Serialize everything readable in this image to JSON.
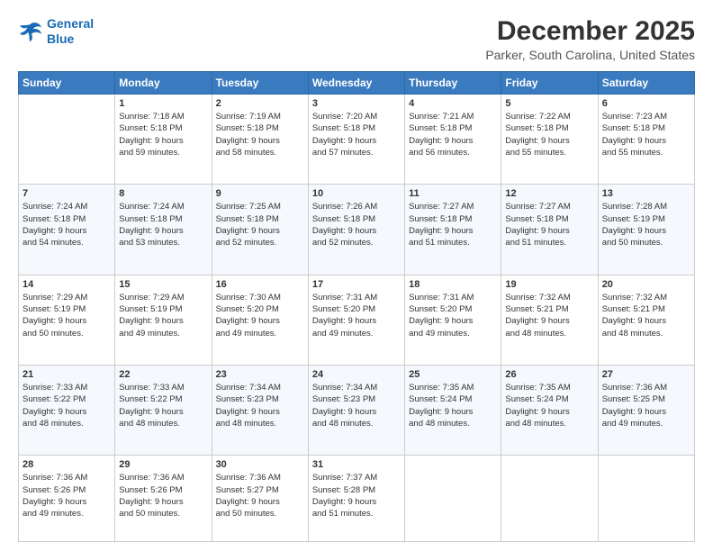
{
  "header": {
    "logo_line1": "General",
    "logo_line2": "Blue",
    "title": "December 2025",
    "subtitle": "Parker, South Carolina, United States"
  },
  "calendar": {
    "days_of_week": [
      "Sunday",
      "Monday",
      "Tuesday",
      "Wednesday",
      "Thursday",
      "Friday",
      "Saturday"
    ],
    "weeks": [
      [
        {
          "day": "",
          "info": ""
        },
        {
          "day": "1",
          "info": "Sunrise: 7:18 AM\nSunset: 5:18 PM\nDaylight: 9 hours\nand 59 minutes."
        },
        {
          "day": "2",
          "info": "Sunrise: 7:19 AM\nSunset: 5:18 PM\nDaylight: 9 hours\nand 58 minutes."
        },
        {
          "day": "3",
          "info": "Sunrise: 7:20 AM\nSunset: 5:18 PM\nDaylight: 9 hours\nand 57 minutes."
        },
        {
          "day": "4",
          "info": "Sunrise: 7:21 AM\nSunset: 5:18 PM\nDaylight: 9 hours\nand 56 minutes."
        },
        {
          "day": "5",
          "info": "Sunrise: 7:22 AM\nSunset: 5:18 PM\nDaylight: 9 hours\nand 55 minutes."
        },
        {
          "day": "6",
          "info": "Sunrise: 7:23 AM\nSunset: 5:18 PM\nDaylight: 9 hours\nand 55 minutes."
        }
      ],
      [
        {
          "day": "7",
          "info": "Sunrise: 7:24 AM\nSunset: 5:18 PM\nDaylight: 9 hours\nand 54 minutes."
        },
        {
          "day": "8",
          "info": "Sunrise: 7:24 AM\nSunset: 5:18 PM\nDaylight: 9 hours\nand 53 minutes."
        },
        {
          "day": "9",
          "info": "Sunrise: 7:25 AM\nSunset: 5:18 PM\nDaylight: 9 hours\nand 52 minutes."
        },
        {
          "day": "10",
          "info": "Sunrise: 7:26 AM\nSunset: 5:18 PM\nDaylight: 9 hours\nand 52 minutes."
        },
        {
          "day": "11",
          "info": "Sunrise: 7:27 AM\nSunset: 5:18 PM\nDaylight: 9 hours\nand 51 minutes."
        },
        {
          "day": "12",
          "info": "Sunrise: 7:27 AM\nSunset: 5:18 PM\nDaylight: 9 hours\nand 51 minutes."
        },
        {
          "day": "13",
          "info": "Sunrise: 7:28 AM\nSunset: 5:19 PM\nDaylight: 9 hours\nand 50 minutes."
        }
      ],
      [
        {
          "day": "14",
          "info": "Sunrise: 7:29 AM\nSunset: 5:19 PM\nDaylight: 9 hours\nand 50 minutes."
        },
        {
          "day": "15",
          "info": "Sunrise: 7:29 AM\nSunset: 5:19 PM\nDaylight: 9 hours\nand 49 minutes."
        },
        {
          "day": "16",
          "info": "Sunrise: 7:30 AM\nSunset: 5:20 PM\nDaylight: 9 hours\nand 49 minutes."
        },
        {
          "day": "17",
          "info": "Sunrise: 7:31 AM\nSunset: 5:20 PM\nDaylight: 9 hours\nand 49 minutes."
        },
        {
          "day": "18",
          "info": "Sunrise: 7:31 AM\nSunset: 5:20 PM\nDaylight: 9 hours\nand 49 minutes."
        },
        {
          "day": "19",
          "info": "Sunrise: 7:32 AM\nSunset: 5:21 PM\nDaylight: 9 hours\nand 48 minutes."
        },
        {
          "day": "20",
          "info": "Sunrise: 7:32 AM\nSunset: 5:21 PM\nDaylight: 9 hours\nand 48 minutes."
        }
      ],
      [
        {
          "day": "21",
          "info": "Sunrise: 7:33 AM\nSunset: 5:22 PM\nDaylight: 9 hours\nand 48 minutes."
        },
        {
          "day": "22",
          "info": "Sunrise: 7:33 AM\nSunset: 5:22 PM\nDaylight: 9 hours\nand 48 minutes."
        },
        {
          "day": "23",
          "info": "Sunrise: 7:34 AM\nSunset: 5:23 PM\nDaylight: 9 hours\nand 48 minutes."
        },
        {
          "day": "24",
          "info": "Sunrise: 7:34 AM\nSunset: 5:23 PM\nDaylight: 9 hours\nand 48 minutes."
        },
        {
          "day": "25",
          "info": "Sunrise: 7:35 AM\nSunset: 5:24 PM\nDaylight: 9 hours\nand 48 minutes."
        },
        {
          "day": "26",
          "info": "Sunrise: 7:35 AM\nSunset: 5:24 PM\nDaylight: 9 hours\nand 48 minutes."
        },
        {
          "day": "27",
          "info": "Sunrise: 7:36 AM\nSunset: 5:25 PM\nDaylight: 9 hours\nand 49 minutes."
        }
      ],
      [
        {
          "day": "28",
          "info": "Sunrise: 7:36 AM\nSunset: 5:26 PM\nDaylight: 9 hours\nand 49 minutes."
        },
        {
          "day": "29",
          "info": "Sunrise: 7:36 AM\nSunset: 5:26 PM\nDaylight: 9 hours\nand 50 minutes."
        },
        {
          "day": "30",
          "info": "Sunrise: 7:36 AM\nSunset: 5:27 PM\nDaylight: 9 hours\nand 50 minutes."
        },
        {
          "day": "31",
          "info": "Sunrise: 7:37 AM\nSunset: 5:28 PM\nDaylight: 9 hours\nand 51 minutes."
        },
        {
          "day": "",
          "info": ""
        },
        {
          "day": "",
          "info": ""
        },
        {
          "day": "",
          "info": ""
        }
      ]
    ]
  }
}
